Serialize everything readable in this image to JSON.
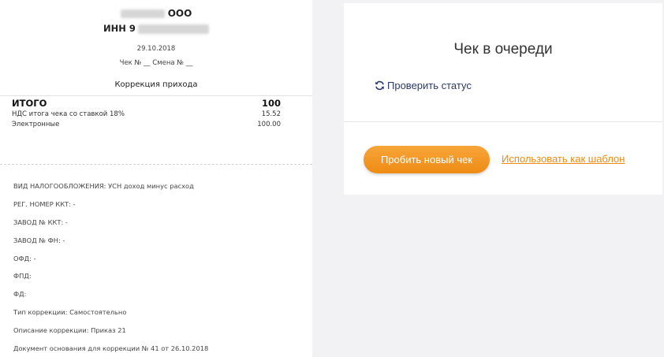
{
  "receipt": {
    "org_suffix": "ООО",
    "inn_label": "ИНН 9",
    "date": "29.10.2018",
    "receipt_shift": "Чек № __ Смена № __",
    "correction_type": "Коррекция прихода",
    "total_label": "ИТОГО",
    "total_value": "100",
    "vat_label": "НДС итога чека со ставкой 18%",
    "vat_value": "15.52",
    "electronic_label": "Электронные",
    "electronic_value": "100.00",
    "details": [
      "ВИД НАЛОГООБЛОЖЕНИЯ: УСН доход минус расход",
      "РЕГ. НОМЕР ККТ: -",
      "ЗАВОД № ККТ: -",
      "ЗАВОД № ФН: -",
      "ОФД: -",
      "ФПД:",
      "ФД:",
      "Тип коррекции: Самостоятельно",
      "Описание коррекции: Приказ 21",
      "Документ основания для коррекции № 41 от 26.10.2018"
    ]
  },
  "status_card": {
    "title": "Чек в очереди",
    "check_status_label": "Проверить статус",
    "check_status_icon": "refresh-icon",
    "new_receipt_button": "Пробить новый чек",
    "use_template_link": "Использовать как шаблон",
    "accent_color": "#ee8b13",
    "link_color": "#2b3a6b"
  }
}
